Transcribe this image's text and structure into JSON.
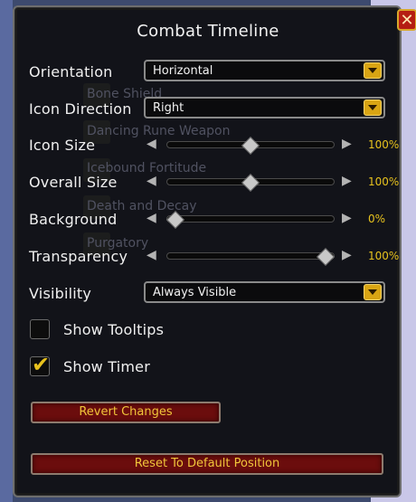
{
  "window": {
    "title": "Combat Timeline",
    "close_label": "✕"
  },
  "background_ghost_items": [
    "Bone Shield",
    "Dancing Rune Weapon",
    "Icebound Fortitude",
    "Death and Decay",
    "Purgatory"
  ],
  "options": {
    "orientation": {
      "label": "Orientation",
      "value": "Horizontal"
    },
    "icon_direction": {
      "label": "Icon Direction",
      "value": "Right"
    },
    "icon_size": {
      "label": "Icon Size",
      "percent": "100%",
      "level": 0.5
    },
    "overall_size": {
      "label": "Overall Size",
      "percent": "100%",
      "level": 0.5
    },
    "background": {
      "label": "Background",
      "percent": "0%",
      "level": 0.0
    },
    "transparency": {
      "label": "Transparency",
      "percent": "100%",
      "level": 1.0
    },
    "visibility": {
      "label": "Visibility",
      "value": "Always Visible"
    },
    "show_tooltips": {
      "label": "Show Tooltips",
      "checked": false
    },
    "show_timer": {
      "label": "Show Timer",
      "checked": true
    }
  },
  "buttons": {
    "revert": "Revert Changes",
    "reset": "Reset To Default Position"
  },
  "icons": {
    "left": "◀",
    "right": "▶",
    "check": "✔"
  },
  "colors": {
    "accent_gold": "#e7c21e",
    "button_red": "#6b0d0d",
    "close_red": "#b51e12"
  }
}
